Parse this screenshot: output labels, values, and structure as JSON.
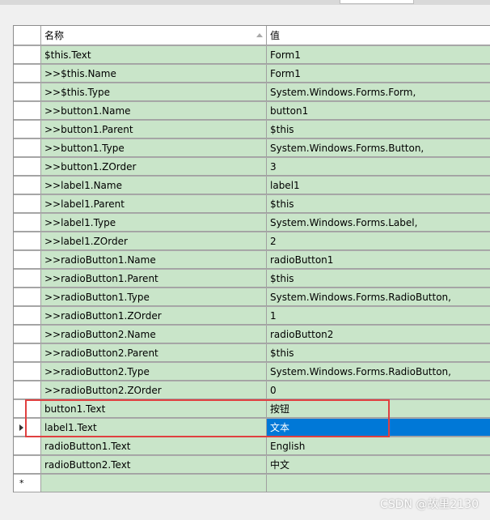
{
  "grid": {
    "columns": {
      "name": "名称",
      "value": "值"
    },
    "rows": [
      {
        "name": "$this.Text",
        "value": "Form1"
      },
      {
        "name": ">>$this.Name",
        "value": "Form1"
      },
      {
        "name": ">>$this.Type",
        "value": "System.Windows.Forms.Form,"
      },
      {
        "name": ">>button1.Name",
        "value": "button1"
      },
      {
        "name": ">>button1.Parent",
        "value": "$this"
      },
      {
        "name": ">>button1.Type",
        "value": "System.Windows.Forms.Button,"
      },
      {
        "name": ">>button1.ZOrder",
        "value": "3"
      },
      {
        "name": ">>label1.Name",
        "value": "label1"
      },
      {
        "name": ">>label1.Parent",
        "value": "$this"
      },
      {
        "name": ">>label1.Type",
        "value": "System.Windows.Forms.Label,"
      },
      {
        "name": ">>label1.ZOrder",
        "value": "2"
      },
      {
        "name": ">>radioButton1.Name",
        "value": "radioButton1"
      },
      {
        "name": ">>radioButton1.Parent",
        "value": "$this"
      },
      {
        "name": ">>radioButton1.Type",
        "value": "System.Windows.Forms.RadioButton,"
      },
      {
        "name": ">>radioButton1.ZOrder",
        "value": "1"
      },
      {
        "name": ">>radioButton2.Name",
        "value": "radioButton2"
      },
      {
        "name": ">>radioButton2.Parent",
        "value": "$this"
      },
      {
        "name": ">>radioButton2.Type",
        "value": "System.Windows.Forms.RadioButton,"
      },
      {
        "name": ">>radioButton2.ZOrder",
        "value": "0"
      },
      {
        "name": "button1.Text",
        "value": "按钮"
      },
      {
        "name": "label1.Text",
        "value": "文本"
      },
      {
        "name": "radioButton1.Text",
        "value": "English"
      },
      {
        "name": "radioButton2.Text",
        "value": "中文"
      }
    ],
    "current_row_index": 20,
    "selected_cell": "value",
    "new_row_marker": "*"
  },
  "colors": {
    "row_bg": "#c9e5c9",
    "selection": "#0078d7",
    "highlight_box": "#e04040"
  },
  "watermark": "CSDN @故里2130"
}
